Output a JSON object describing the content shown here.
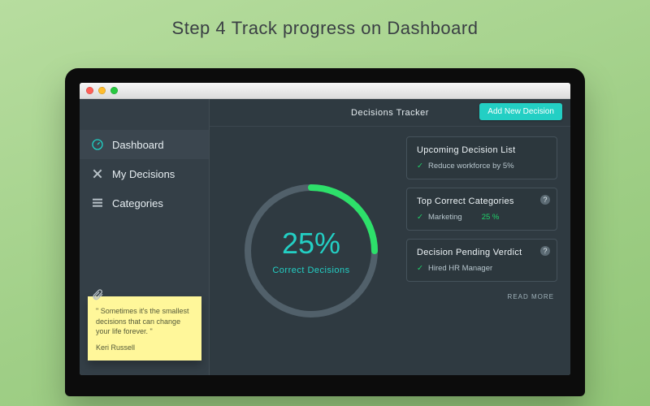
{
  "headline_prefix": "Step 4 ",
  "headline_bold": "Track progress on Dashboard",
  "window": {
    "app_title": "Decisions Tracker",
    "add_button": "Add New Decision"
  },
  "sidebar": {
    "items": [
      {
        "label": "Dashboard"
      },
      {
        "label": "My Decisions"
      },
      {
        "label": "Categories"
      }
    ],
    "note": {
      "quote": "\" Sometimes it's the smallest decisions that can change your life forever. \"",
      "author": "Keri Russell"
    }
  },
  "gauge": {
    "percent_label": "25%",
    "percent_value": 25,
    "caption": "Correct Decisions"
  },
  "panels": {
    "upcoming": {
      "title": "Upcoming Decision List",
      "item": "Reduce workforce by 5%"
    },
    "top_categories": {
      "title": "Top Correct Categories",
      "item": "Marketing",
      "pct": "25 %"
    },
    "pending": {
      "title": "Decision Pending Verdict",
      "item": "Hired HR Manager"
    },
    "read_more": "READ MORE"
  }
}
